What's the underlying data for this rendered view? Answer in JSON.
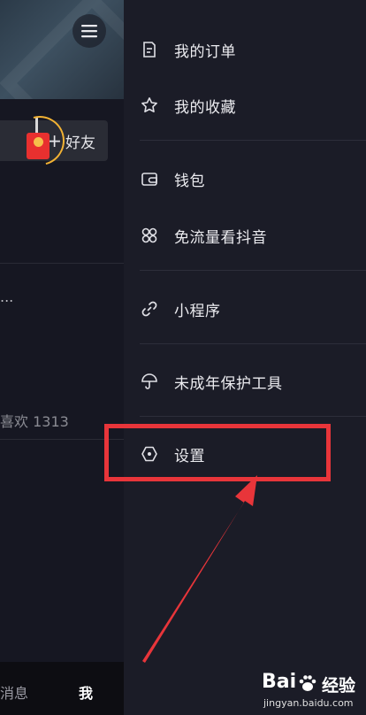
{
  "profile": {
    "add_friend_label": "好友",
    "add_friend_plus": "+",
    "truncated_text": "...",
    "likes_text": "喜欢 1313"
  },
  "tabbar": {
    "messages_label": "消息",
    "me_label": "我"
  },
  "drawer": {
    "groups": [
      {
        "items": [
          {
            "label": "我的订单",
            "icon": "order-icon"
          },
          {
            "label": "我的收藏",
            "icon": "star-icon"
          }
        ]
      },
      {
        "items": [
          {
            "label": "钱包",
            "icon": "wallet-icon"
          },
          {
            "label": "免流量看抖音",
            "icon": "four-leaf-icon"
          }
        ]
      },
      {
        "items": [
          {
            "label": "小程序",
            "icon": "link-icon"
          }
        ]
      },
      {
        "items": [
          {
            "label": "未成年保护工具",
            "icon": "umbrella-icon"
          }
        ]
      },
      {
        "items": [
          {
            "label": "设置",
            "icon": "settings-hexagon-icon"
          }
        ]
      }
    ]
  },
  "annotation": {
    "highlight_color": "#e8353a"
  },
  "watermark": {
    "brand": "Bai",
    "brand_cn": "经验",
    "url": "jingyan.baidu.com"
  },
  "colors": {
    "drawer_bg": "#1b1c27",
    "page_bg": "#161722",
    "accent_red": "#e8302f"
  }
}
